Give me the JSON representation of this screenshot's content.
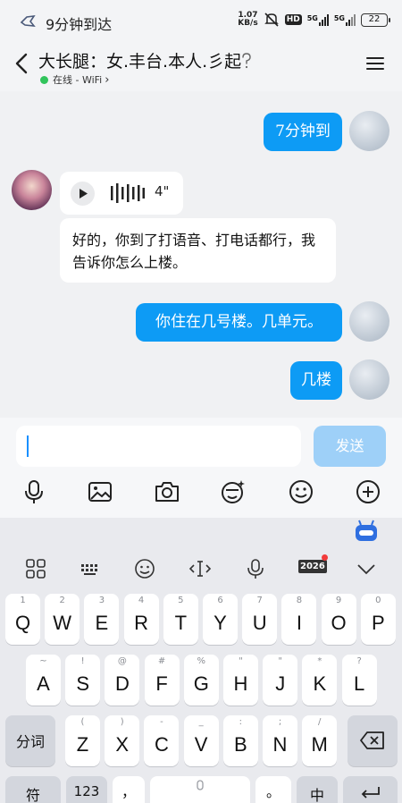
{
  "status_bar": {
    "app_icon": "bird-app-icon",
    "status_text": "9分钟到达",
    "speed_value": "1.07",
    "speed_unit": "KB/s",
    "hd_label": "HD",
    "network_1": "5G",
    "network_2": "5G",
    "battery": "22"
  },
  "header": {
    "title": "大长腿：女.丰台.本人.彡起",
    "status": "在线 - WiFi",
    "status_chevron": "›"
  },
  "messages": [
    {
      "direction": "out",
      "text": "7分钟到"
    },
    {
      "direction": "in",
      "type": "voice",
      "duration": "4\""
    },
    {
      "direction": "in",
      "text": "好的，你到了打语音、打电话都行，我告诉你怎么上楼。"
    },
    {
      "direction": "out",
      "text": "你住在几号楼。几单元。"
    },
    {
      "direction": "out",
      "text": "几楼"
    }
  ],
  "input": {
    "value": "",
    "send_label": "发送"
  },
  "toolbar_icons": [
    "microphone-icon",
    "image-icon",
    "camera-icon",
    "sticker-icon",
    "emoji-icon",
    "plus-icon"
  ],
  "keyboard": {
    "toolbar_badge": "2026",
    "row1": [
      {
        "k": "Q",
        "s": "1"
      },
      {
        "k": "W",
        "s": "2"
      },
      {
        "k": "E",
        "s": "3"
      },
      {
        "k": "R",
        "s": "4"
      },
      {
        "k": "T",
        "s": "5"
      },
      {
        "k": "Y",
        "s": "6"
      },
      {
        "k": "U",
        "s": "7"
      },
      {
        "k": "I",
        "s": "8"
      },
      {
        "k": "O",
        "s": "9"
      },
      {
        "k": "P",
        "s": "0"
      }
    ],
    "row2": [
      {
        "k": "A",
        "s": "~"
      },
      {
        "k": "S",
        "s": "!"
      },
      {
        "k": "D",
        "s": "@"
      },
      {
        "k": "F",
        "s": "#"
      },
      {
        "k": "G",
        "s": "%"
      },
      {
        "k": "H",
        "s": "\""
      },
      {
        "k": "J",
        "s": "\""
      },
      {
        "k": "K",
        "s": "*"
      },
      {
        "k": "L",
        "s": "?"
      }
    ],
    "row3": [
      {
        "k": "Z",
        "s": "("
      },
      {
        "k": "X",
        "s": ")"
      },
      {
        "k": "C",
        "s": "-"
      },
      {
        "k": "V",
        "s": "_"
      },
      {
        "k": "B",
        "s": ":"
      },
      {
        "k": "N",
        "s": ";"
      },
      {
        "k": "M",
        "s": "/"
      }
    ],
    "fenci_label": "分词",
    "row4": {
      "symbol": "符",
      "num": "123",
      "comma": "，",
      "period": "。",
      "lang": "中"
    }
  }
}
